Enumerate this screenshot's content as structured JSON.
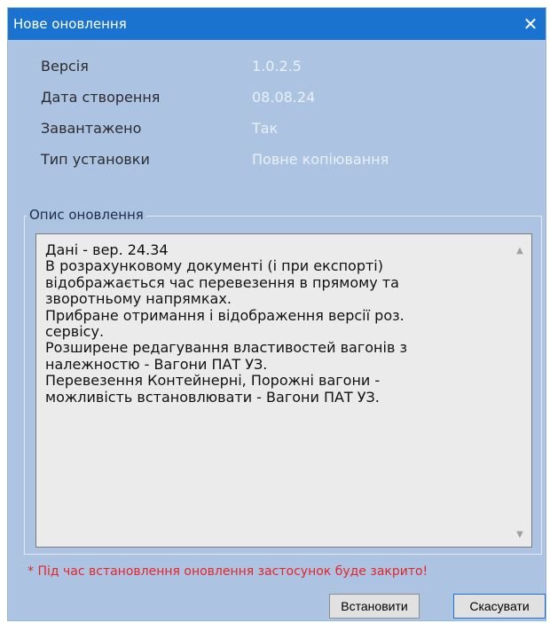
{
  "window": {
    "title": "Нове оновлення",
    "close_glyph": "✕"
  },
  "info": [
    {
      "label": "Версія",
      "value": "1.0.2.5"
    },
    {
      "label": "Дата створення",
      "value": "08.08.24"
    },
    {
      "label": "Завантажено",
      "value": "Так"
    },
    {
      "label": "Тип установки",
      "value": "Повне копіювання"
    }
  ],
  "description": {
    "legend": "Опис оновлення",
    "lines": [
      "Дані - вер. 24.34",
      "В розрахунковому документі (і при експорті)",
      "відображається час перевезення в прямому та",
      "зворотньому напрямках.",
      "Прибране отримання і відображення версії роз.",
      "сервісу.",
      "Розширене редагування властивостей вагонів з",
      "належностю - Вагони ПАТ УЗ.",
      "Перевезення Контейнерні, Порожні вагони -",
      "можливість встановлювати - Вагони ПАТ УЗ."
    ]
  },
  "warning": "* Під час встановлення оновлення застосунок буде закрито!",
  "buttons": {
    "install": "Встановити",
    "cancel": "Скасувати"
  },
  "colors": {
    "titlebar": "#1b73d0",
    "background": "#adc3e2",
    "warning": "#e4262b"
  }
}
